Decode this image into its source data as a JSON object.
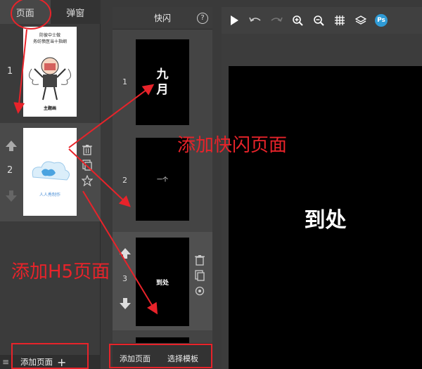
{
  "left_panel": {
    "tabs": [
      {
        "label": "页面"
      },
      {
        "label": "弹窗"
      }
    ],
    "pages": [
      {
        "number": "1",
        "thumb_lines": [
          "防彼中士做",
          "务纺愤医当十指纲"
        ],
        "thumb_caption": "主题画"
      },
      {
        "number": "2",
        "thumb_caption": "人人秀制作"
      }
    ],
    "add_page_label": "添加页面",
    "add_icon": "plus-icon"
  },
  "mid_panel": {
    "title": "快闪",
    "help_label": "?",
    "frames": [
      {
        "number": "1",
        "text": "九\n月"
      },
      {
        "number": "2",
        "text": "一个"
      },
      {
        "number": "3",
        "text": "到处"
      }
    ],
    "add_page_label": "添加页面",
    "choose_template_label": "选择模板"
  },
  "canvas": {
    "text": "到处"
  },
  "toolbar": {
    "icons": [
      "play-icon",
      "undo-icon",
      "redo-icon",
      "zoom-in-icon",
      "zoom-out-icon",
      "grid-icon",
      "layers-icon",
      "ps-icon"
    ],
    "ps_label": "Ps"
  },
  "annotations": {
    "add_flash_page": "添加快闪页面",
    "add_h5_page": "添加H5页面"
  },
  "colors": {
    "accent_red": "#e8232a",
    "ps_blue": "#2f9bd6"
  }
}
